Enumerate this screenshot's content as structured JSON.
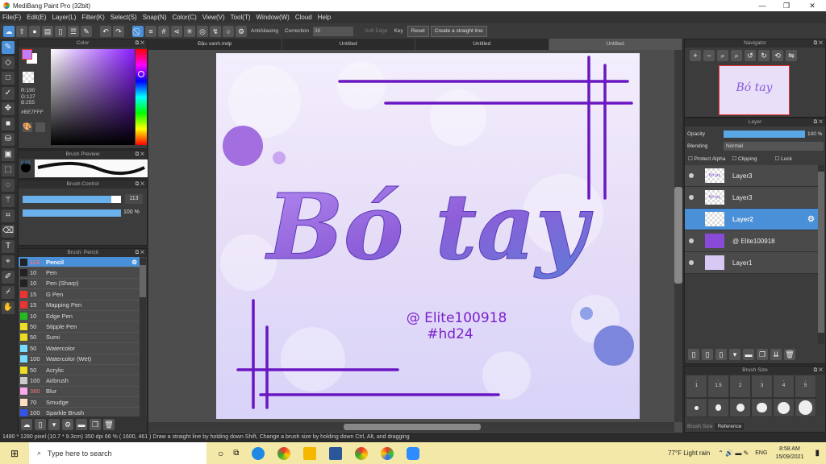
{
  "window": {
    "title": "MediBang Paint Pro (32bit)"
  },
  "menu": [
    "File(F)",
    "Edit(E)",
    "Layer(L)",
    "Filter(K)",
    "Select(S)",
    "Snap(N)",
    "Color(C)",
    "View(V)",
    "Tool(T)",
    "Window(W)",
    "Cloud",
    "Help"
  ],
  "toolbar": {
    "antialiasing": "AntiAliasing",
    "correction_label": "Correction",
    "correction_value": "36",
    "soft_edge": "Soft Edge",
    "key": "Key",
    "reset": "Reset",
    "straight_line": "Create a straight line"
  },
  "tabs": [
    "Đậu xanh.mdp",
    "Untitled",
    "Untitled",
    "Untitled"
  ],
  "color_panel": {
    "title": "Color",
    "r": "R:190",
    "g": "G:127",
    "b": "B:255",
    "hex": "#BE7FFF",
    "main_color": "#be7fff"
  },
  "brush_preview": {
    "title": "Brush Preview",
    "size": "0.85"
  },
  "brush_control": {
    "title": "Brush Control",
    "size": "113",
    "opacity": "100 %",
    "size_fraction": 0.9,
    "opacity_fraction": 1.0
  },
  "brush_panel": {
    "title": "Brush: Pencil",
    "brushes": [
      {
        "size": "113",
        "name": "Pencil",
        "color": "#222222"
      },
      {
        "size": "10",
        "name": "Pen",
        "color": "#222222"
      },
      {
        "size": "10",
        "name": "Pen (Sharp)",
        "color": "#222222"
      },
      {
        "size": "15",
        "name": "G Pen",
        "color": "#ee3333"
      },
      {
        "size": "15",
        "name": "Mapping Pen",
        "color": "#ee3333"
      },
      {
        "size": "10",
        "name": "Edge Pen",
        "color": "#22bb22"
      },
      {
        "size": "50",
        "name": "Stipple Pen",
        "color": "#eedd22"
      },
      {
        "size": "50",
        "name": "Sumi",
        "color": "#eedd22"
      },
      {
        "size": "50",
        "name": "Watercolor",
        "color": "#77ddff"
      },
      {
        "size": "100",
        "name": "Watercolor (Wet)",
        "color": "#77ddff"
      },
      {
        "size": "50",
        "name": "Acrylic",
        "color": "#eedd22"
      },
      {
        "size": "100",
        "name": "Airbrush",
        "color": "#cccccc"
      },
      {
        "size": "380",
        "name": "Blur",
        "color": "#ffaaee"
      },
      {
        "size": "70",
        "name": "Smudge",
        "color": "#ffe0c0"
      },
      {
        "size": "100",
        "name": "Sparkle Brush",
        "color": "#3355ee"
      }
    ]
  },
  "artwork": {
    "title": "Bó tay",
    "credit": "@ Elite100918",
    "tag": "#hd24"
  },
  "navigator": {
    "title": "Navigator"
  },
  "layer_panel": {
    "title": "Layer",
    "opacity_label": "Opacity",
    "opacity": "100 %",
    "blending_label": "Blending",
    "blending": "Normal",
    "protect_alpha": "Protect Alpha",
    "clipping": "Clipping",
    "lock": "Lock",
    "layers": [
      {
        "name": "Layer3",
        "thumb": "Bó tay"
      },
      {
        "name": "Layer3",
        "thumb": "Bó tay"
      },
      {
        "name": "Layer2",
        "thumb": ""
      },
      {
        "name": "@ Elite100918",
        "thumb": ""
      },
      {
        "name": "Layer1",
        "thumb": ""
      }
    ]
  },
  "brush_size": {
    "title": "Brush Size",
    "sizes": [
      "1",
      "1.5",
      "2",
      "3",
      "4",
      "5"
    ],
    "tabs": [
      "Brush Size",
      "Reference"
    ]
  },
  "status": "1480 * 1280 pixel  (10.7 * 9.3cm)  350 dpi  66 %  ( 1600, 461 )  Draw a straight line by holding down Shift, Change a brush size by holding down Ctrl, Alt, and dragging",
  "taskbar": {
    "search": "Type here to search",
    "weather": "77°F  Light rain",
    "lang": "ENG",
    "time": "8:58 AM",
    "date": "15/09/2021"
  }
}
